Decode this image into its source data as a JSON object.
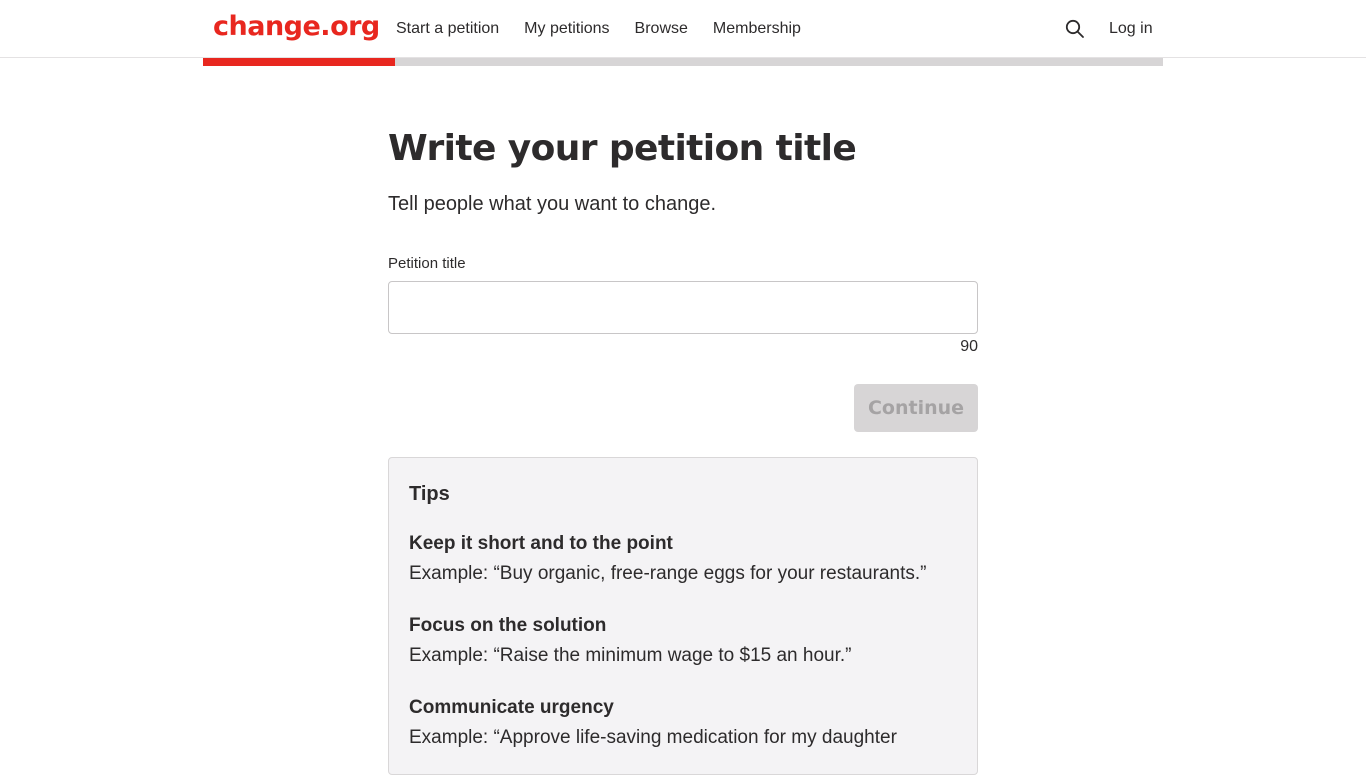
{
  "header": {
    "logo_text": "change.org",
    "nav": [
      {
        "label": "Start a petition"
      },
      {
        "label": "My petitions"
      },
      {
        "label": "Browse"
      },
      {
        "label": "Membership"
      }
    ],
    "search_icon": "search-icon",
    "login_label": "Log in"
  },
  "progress": {
    "step_fraction": 0.2,
    "fill_color": "#e8271f",
    "track_color": "#d7d5d6"
  },
  "main": {
    "title": "Write your petition title",
    "subtitle": "Tell people what you want to change.",
    "field_label": "Petition title",
    "field_value": "",
    "char_count": "90",
    "continue_label": "Continue"
  },
  "tips": {
    "title": "Tips",
    "items": [
      {
        "heading": "Keep it short and to the point",
        "example": "Example: “Buy organic, free-range eggs for your restaurants.”"
      },
      {
        "heading": "Focus on the solution",
        "example": "Example: “Raise the minimum wage to $15 an hour.”"
      },
      {
        "heading": "Communicate urgency",
        "example": "Example: “Approve life-saving medication for my daughter"
      }
    ]
  },
  "colors": {
    "brand": "#e8271f",
    "text": "#2d2b2c",
    "tips_bg": "#f4f3f5",
    "disabled_button": "#d7d5d6"
  }
}
